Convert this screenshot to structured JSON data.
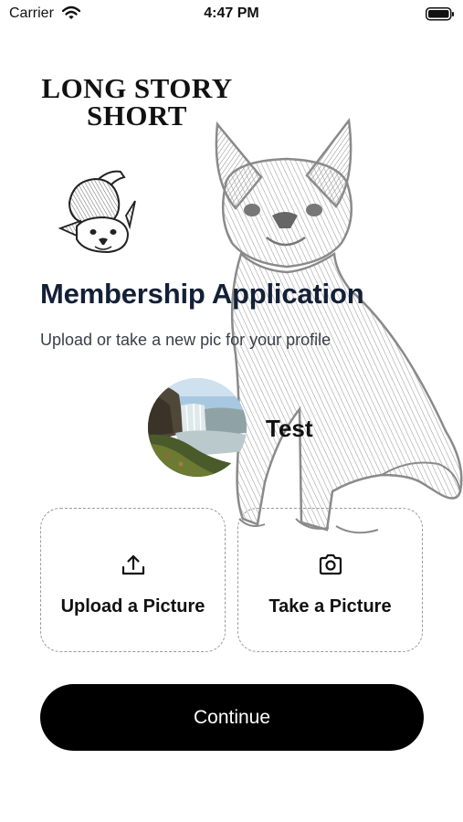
{
  "status_bar": {
    "carrier": "Carrier",
    "time": "4:47 PM",
    "icons": [
      "wifi-icon",
      "battery-icon"
    ]
  },
  "logo": {
    "line1": "LONG STORY",
    "line2": "SHORT"
  },
  "header": {
    "title": "Membership Application",
    "subtitle": "Upload or take a new pic for your profile"
  },
  "profile": {
    "name": "Test",
    "avatar": "waterfall-landscape-photo"
  },
  "actions": {
    "upload": {
      "label": "Upload a Picture",
      "icon": "upload-icon"
    },
    "camera": {
      "label": "Take a Picture",
      "icon": "camera-icon"
    }
  },
  "continue_label": "Continue",
  "colors": {
    "title": "#142036",
    "button_bg": "#000000",
    "button_text": "#ffffff",
    "card_border": "#9a9a9a"
  }
}
